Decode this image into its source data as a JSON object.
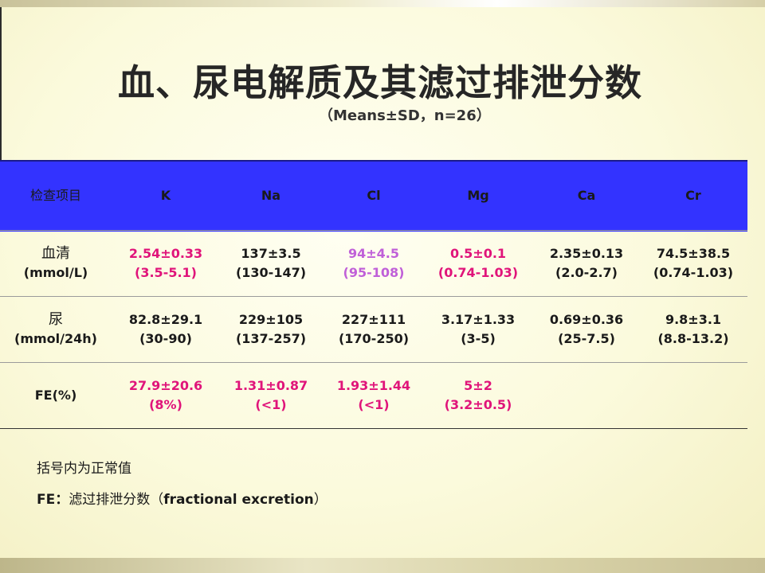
{
  "slide": {
    "title": "血、尿电解质及其滤过排泄分数",
    "subtitle": "（Means±SD，n=26）"
  },
  "table": {
    "headers": [
      "检查项目",
      "K",
      "Na",
      "Cl",
      "Mg",
      "Ca",
      "Cr"
    ],
    "rows": [
      {
        "label": [
          "血清",
          "(mmol/L)"
        ],
        "cells": [
          {
            "value": "2.54±0.33",
            "range": "(3.5-5.1)",
            "color": "#e0147a"
          },
          {
            "value": "137±3.5",
            "range": "(130-147)",
            "color": "#1a1a1a"
          },
          {
            "value": "94±4.5",
            "range": "(95-108)",
            "color": "#c060d8"
          },
          {
            "value": "0.5±0.1",
            "range": "(0.74-1.03)",
            "color": "#e0147a"
          },
          {
            "value": "2.35±0.13",
            "range": "(2.0-2.7)",
            "color": "#1a1a1a"
          },
          {
            "value": "74.5±38.5",
            "range": "(0.74-1.03)",
            "color": "#1a1a1a"
          }
        ]
      },
      {
        "label": [
          "尿",
          "(mmol/24h)"
        ],
        "cells": [
          {
            "value": "82.8±29.1",
            "range": "(30-90)",
            "color": "#1a1a1a"
          },
          {
            "value": "229±105",
            "range": "(137-257)",
            "color": "#1a1a1a"
          },
          {
            "value": "227±111",
            "range": "(170-250)",
            "color": "#1a1a1a"
          },
          {
            "value": "3.17±1.33",
            "range": "(3-5)",
            "color": "#1a1a1a"
          },
          {
            "value": "0.69±0.36",
            "range": "(25-7.5)",
            "color": "#1a1a1a"
          },
          {
            "value": "9.8±3.1",
            "range": "(8.8-13.2)",
            "color": "#1a1a1a"
          }
        ]
      },
      {
        "label": [
          "FE(%)"
        ],
        "cells": [
          {
            "value": "27.9±20.6",
            "range": "(8%)",
            "color": "#e0147a"
          },
          {
            "value": "1.31±0.87",
            "range": "(<1)",
            "color": "#e0147a"
          },
          {
            "value": "1.93±1.44",
            "range": "(<1)",
            "color": "#e0147a"
          },
          {
            "value": "5±2",
            "range": "(3.2±0.5)",
            "color": "#e0147a"
          },
          {
            "value": "",
            "range": "",
            "color": "#1a1a1a"
          },
          {
            "value": "",
            "range": "",
            "color": "#1a1a1a"
          }
        ]
      }
    ]
  },
  "notes": {
    "line1": "括号内为正常值",
    "line2_prefix": "FE：",
    "line2_cn": "滤过排泄分数（",
    "line2_en": "fractional excretion",
    "line2_end": "）"
  },
  "colors": {
    "header_bg": "#3333ff",
    "accent_pink": "#e0147a",
    "accent_purple": "#c060d8",
    "background": "#fbfadc"
  }
}
